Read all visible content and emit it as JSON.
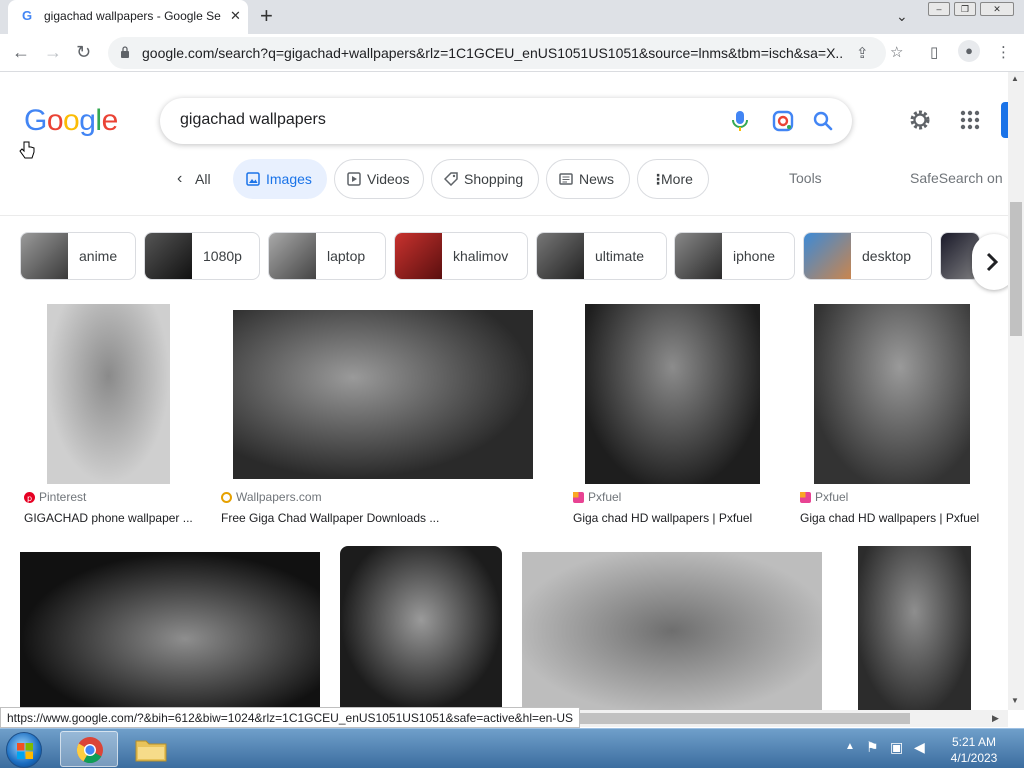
{
  "browser": {
    "tab_title": "gigachad wallpapers - Google Se",
    "url": "google.com/search?q=gigachad+wallpapers&rlz=1C1GCEU_enUS1051US1051&source=lnms&tbm=isch&sa=X...",
    "status_url": "https://www.google.com/?&bih=612&biw=1024&rlz=1C1GCEU_enUS1051US1051&safe=active&hl=en-US"
  },
  "google": {
    "logo": [
      "G",
      "o",
      "o",
      "g",
      "l",
      "e"
    ],
    "logo_colors": [
      "#4285f4",
      "#ea4335",
      "#fbbc05",
      "#4285f4",
      "#34a853",
      "#ea4335"
    ],
    "search_query": "gigachad wallpapers"
  },
  "filters": {
    "all": "All",
    "images": "Images",
    "videos": "Videos",
    "shopping": "Shopping",
    "news": "News",
    "more": "More",
    "tools": "Tools",
    "safesearch": "SafeSearch on"
  },
  "chips": [
    "anime",
    "1080p",
    "laptop",
    "khalimov",
    "ultimate",
    "iphone",
    "desktop"
  ],
  "results_row1": [
    {
      "source": "Pinterest",
      "title": "GIGACHAD phone wallpaper ..."
    },
    {
      "source": "Wallpapers.com",
      "title": "Free Giga Chad Wallpaper Downloads ..."
    },
    {
      "source": "Pxfuel",
      "title": "Giga chad HD wallpapers | Pxfuel"
    },
    {
      "source": "Pxfuel",
      "title": "Giga chad HD wallpapers | Pxfuel"
    }
  ],
  "taskbar": {
    "time": "5:21 AM",
    "date": "4/1/2023"
  },
  "colors": {
    "accent": "#1a73e8",
    "pill_active_bg": "#e8f0fe"
  }
}
